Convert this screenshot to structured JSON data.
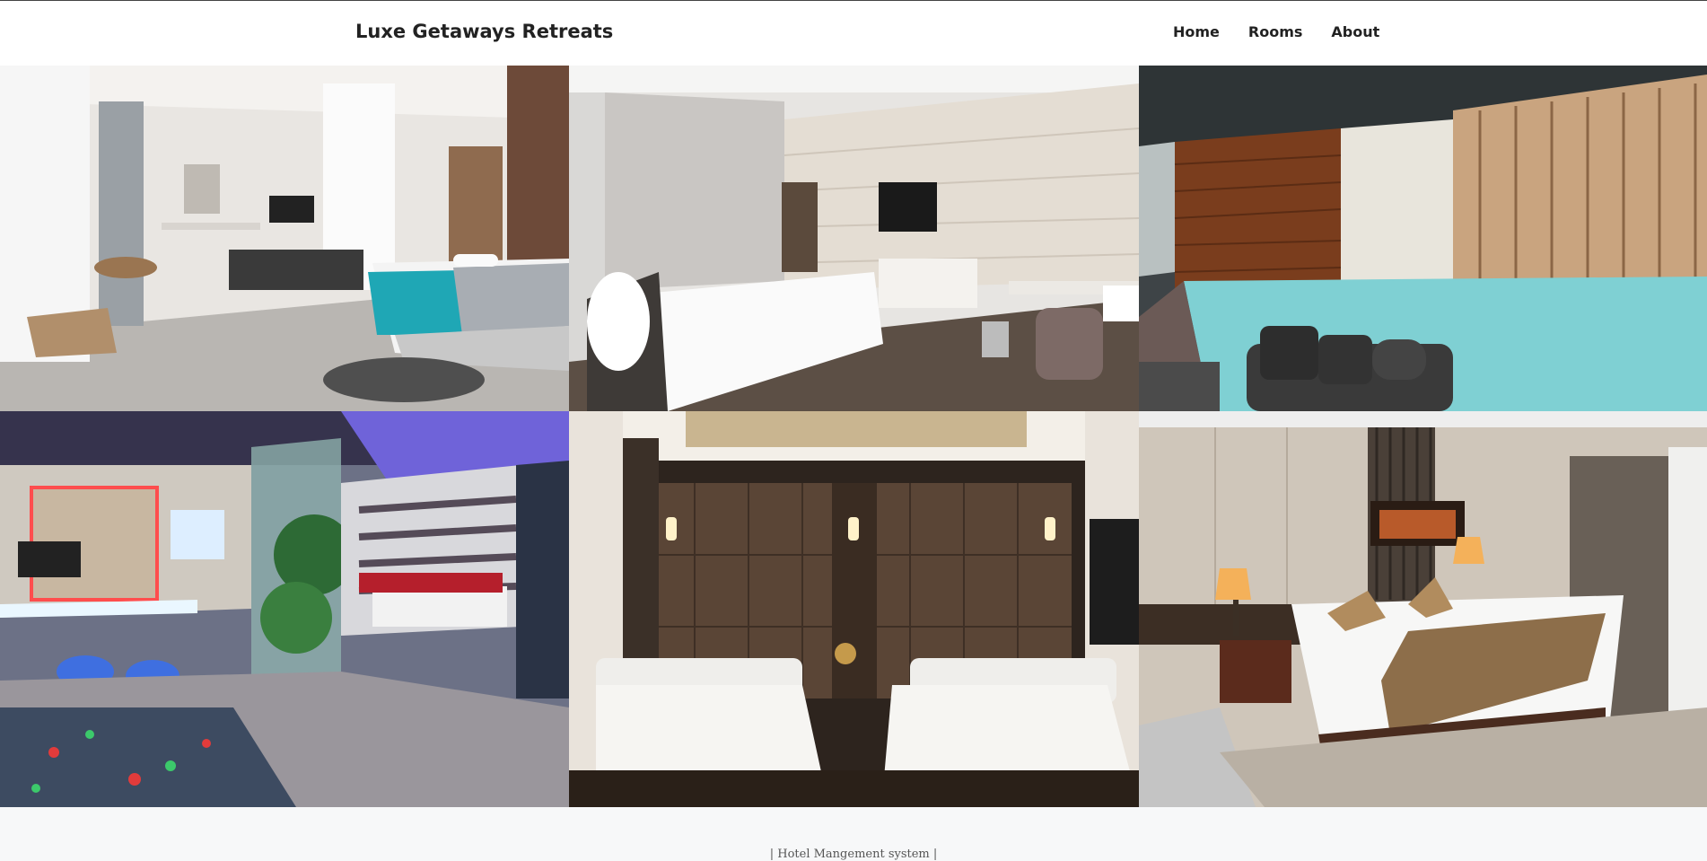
{
  "header": {
    "brand": "Luxe Getaways Retreats",
    "nav": [
      {
        "label": "Home"
      },
      {
        "label": "Rooms"
      },
      {
        "label": "About"
      }
    ]
  },
  "gallery": {
    "tiles": [
      {
        "icon": "living-suite-photo"
      },
      {
        "icon": "hotel-bedroom-photo"
      },
      {
        "icon": "indoor-pool-photo"
      },
      {
        "icon": "neon-suite-photo"
      },
      {
        "icon": "twin-bed-room-photo"
      },
      {
        "icon": "king-bed-room-photo"
      }
    ]
  },
  "footer": {
    "text": "| Hotel Mangement system |"
  },
  "colors": {
    "navbar_bg": "#ffffff",
    "page_bg": "#f7f8f9",
    "text": "#222222",
    "pool_water": "#7fd0d3",
    "accent_teal": "#1fa7b5"
  }
}
